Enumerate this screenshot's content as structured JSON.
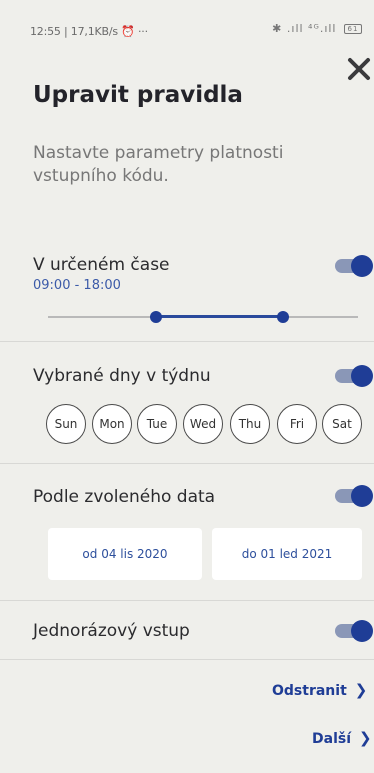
{
  "status_bar": {
    "time": "12:55 | 17,1KB/s",
    "extra": "···",
    "signal": "✱ .ıll  ⁴ᴳ.ıll",
    "battery": "61"
  },
  "header": {
    "title": "Upravit pravidla",
    "subtitle": "Nastavte parametry platnosti vstupního kódu."
  },
  "rules": {
    "time": {
      "label": "V určeném čase",
      "enabled": true,
      "range": "09:00 - 18:00"
    },
    "weekdays": {
      "label": "Vybrané dny v týdnu",
      "enabled": true,
      "days": [
        "Sun",
        "Mon",
        "Tue",
        "Wed",
        "Thu",
        "Fri",
        "Sat"
      ]
    },
    "date": {
      "label": "Podle zvoleného data",
      "enabled": true,
      "from": "od 04 lis 2020",
      "to": "do 01 led 2021"
    },
    "single": {
      "label": "Jednorázový vstup",
      "enabled": true
    }
  },
  "actions": {
    "remove_label": "Odstranit",
    "next_label": "Další"
  },
  "colors": {
    "background": "#efefeb",
    "accent": "#1f3d96",
    "toggle_track": "#8a97b7"
  }
}
